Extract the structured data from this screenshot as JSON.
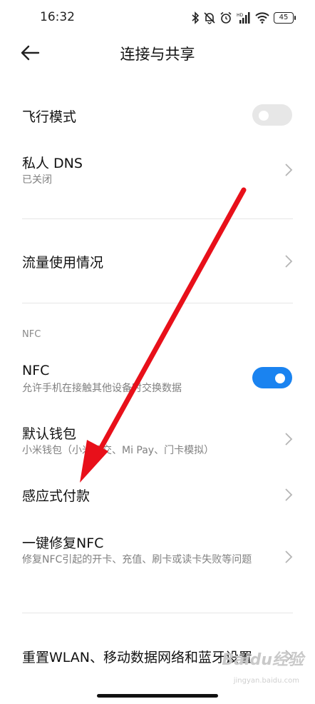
{
  "status_bar": {
    "time": "16:32",
    "battery": "45",
    "network": "HD"
  },
  "header": {
    "title": "连接与共享"
  },
  "items": {
    "airplane": {
      "title": "飞行模式",
      "enabled": false
    },
    "private_dns": {
      "title": "私人 DNS",
      "subtitle": "已关闭"
    },
    "data_usage": {
      "title": "流量使用情况"
    },
    "nfc_section": {
      "label": "NFC"
    },
    "nfc": {
      "title": "NFC",
      "subtitle": "允许手机在接触其他设备时交换数据",
      "enabled": true
    },
    "default_wallet": {
      "title": "默认钱包",
      "subtitle": "小米钱包（小米公交、Mi Pay、门卡模拟）"
    },
    "tap_pay": {
      "title": "感应式付款"
    },
    "repair_nfc": {
      "title": "一键修复NFC",
      "subtitle": "修复NFC引起的开卡、充值、刷卡或读卡失败等问题"
    },
    "reset_network": {
      "title": "重置WLAN、移动数据网络和蓝牙设置"
    }
  },
  "watermark": {
    "text": "Baidu经验",
    "sub": "jingyan.baidu.com"
  },
  "colors": {
    "toggle_on": "#1a83f0",
    "toggle_off": "#e7e7e7",
    "arrow": "#e8101a"
  }
}
